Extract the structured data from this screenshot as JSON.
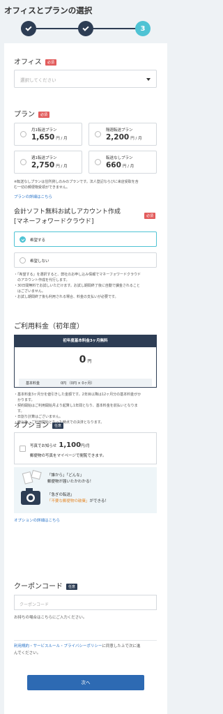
{
  "header": {
    "title": "オフィスとプランの選択",
    "steps": [
      {
        "label": "",
        "state": "done"
      },
      {
        "label": "",
        "state": "done"
      },
      {
        "label": "3",
        "state": "active"
      }
    ]
  },
  "office": {
    "title": "オフィス",
    "required": "必須",
    "placeholder": "選択してください"
  },
  "plan": {
    "title": "プラン",
    "required": "必須",
    "options": [
      {
        "name": "月1転送プラン",
        "price": "1,650",
        "unit": "円 / 月"
      },
      {
        "name": "隔週転送プラン",
        "price": "2,200",
        "unit": "円 / 月"
      },
      {
        "name": "週1転送プラン",
        "price": "2,750",
        "unit": "円 / 月"
      },
      {
        "name": "転送なしプラン",
        "price": "660",
        "unit": "円 / 月"
      }
    ],
    "note1": "※転送なしプランは住所貸しのみのプランです。法人登記ならびに来店受取を含",
    "note2": "む一切の郵便物受領ができません。",
    "details_link": "プランの詳細はこちら"
  },
  "accounting": {
    "title_line1": "会計ソフト無料お試しアカウント作成",
    "title_line2": "[マネーフォワードクラウド]",
    "required": "必須",
    "opt_yes": "希望する",
    "opt_no": "希望しない",
    "notes": [
      "・「希望する」を選択すると、弊社のお申し込み情報でマネーフォワードクラウド",
      "　のアカウント作成を代行します。",
      "・30日間無料でお試しいただけます。お試し期間終了後に自動で課金されること",
      "　はございません。",
      "・お試し期間終了後も利用される場合、料金の支払いが必要です。"
    ]
  },
  "fee": {
    "title": "ご利用料金（初年度）",
    "banner": "初年度基本料金3ヶ月無料",
    "amount": "0",
    "yen": "円",
    "row_key": "基本料金",
    "row_value": "0円 （0円 × 0ヶ月）",
    "notes": [
      "・基本料金3ヶ月分を値引きした金額です。2年目以降は12ヶ月分の基本料金がか",
      "　かります。",
      "・契約開始はご利用開始月より起算し1年間となり、基本料金を前払いとなりま",
      "　す。",
      "・日割り計算はございません。",
      "・申込後、ご利用開始となった時点での決済となります。"
    ]
  },
  "option": {
    "title": "オプション",
    "badge": "任意",
    "item_label": "写真でお知らせ",
    "item_price": "1,100",
    "item_unit": "円/月",
    "item_desc": "郵便物の写真をマイページで閲覧できます。",
    "illus_line1a": "「誰から」「どんな」",
    "illus_line1b": "郵便物が届いたかわかる！",
    "illus_line2a": "「急ぎの転送」",
    "illus_line2b_pre": "「不要な郵便物の破棄」",
    "illus_line2b_post": "ができる！",
    "details_link": "オプションの詳細はこちら"
  },
  "coupon": {
    "title": "クーポンコード",
    "badge": "任意",
    "placeholder": "クーポンコード",
    "note": "お持ちの場合はこちらにご入力ください。"
  },
  "terms": {
    "link_text": "利用規約・サービスルール・プライバシーポリシー",
    "text_after": "に同意した上で次に進",
    "text_line2": "んでください。"
  },
  "next_button": "次へ",
  "colors": {
    "navy": "#2d3d54",
    "cyan": "#4fc3d4",
    "required_red": "#e25c5c",
    "link_blue": "#2a74c9",
    "button_blue": "#2d6ab3"
  }
}
